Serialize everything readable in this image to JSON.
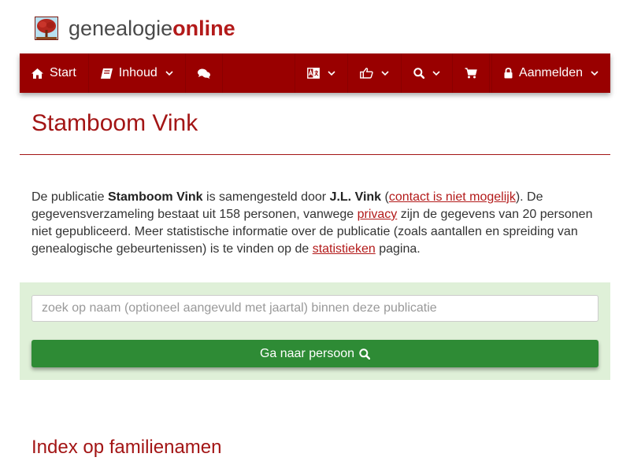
{
  "brand": {
    "light": "genealogie",
    "bold": "online"
  },
  "nav": {
    "start_label": "Start",
    "inhoud_label": "Inhoud",
    "login_label": "Aanmelden"
  },
  "page": {
    "title": "Stamboom Vink"
  },
  "intro": {
    "p1": "De publicatie ",
    "pub_name": "Stamboom Vink",
    "p2": " is samengesteld door ",
    "author": "J.L. Vink",
    "p3": " (",
    "contact_link": "contact is niet mogelijk",
    "p4": "). De gegevensverzameling bestaat uit 158 personen, vanwege ",
    "privacy_link": "privacy",
    "p5": " zijn de gegevens van 20 personen niet gepubliceerd. Meer statistische informatie over de publicatie (zoals aantallen en spreiding van genealogische gebeurtenissen) is te vinden op de ",
    "stats_link": "statistieken",
    "p6": " pagina."
  },
  "search": {
    "placeholder": "zoek op naam (optioneel aangevuld met jaartal) binnen deze publicatie",
    "value": "",
    "button_label": "Ga naar persoon"
  },
  "index": {
    "title": "Index op familienamen"
  },
  "colors": {
    "brand_red": "#b31a1a",
    "navbar": "#990000",
    "search_panel": "#dff0d8",
    "button_green": "#2e8b35"
  },
  "icons": {
    "logo": "tree-icon",
    "start": "home-icon",
    "inhoud": "book-icon",
    "chat": "comments-icon",
    "language": "language-icon",
    "share": "thumbs-up-icon",
    "search": "search-icon",
    "shop": "cart-icon",
    "login": "lock-icon",
    "dropdown": "chevron-down-icon"
  }
}
